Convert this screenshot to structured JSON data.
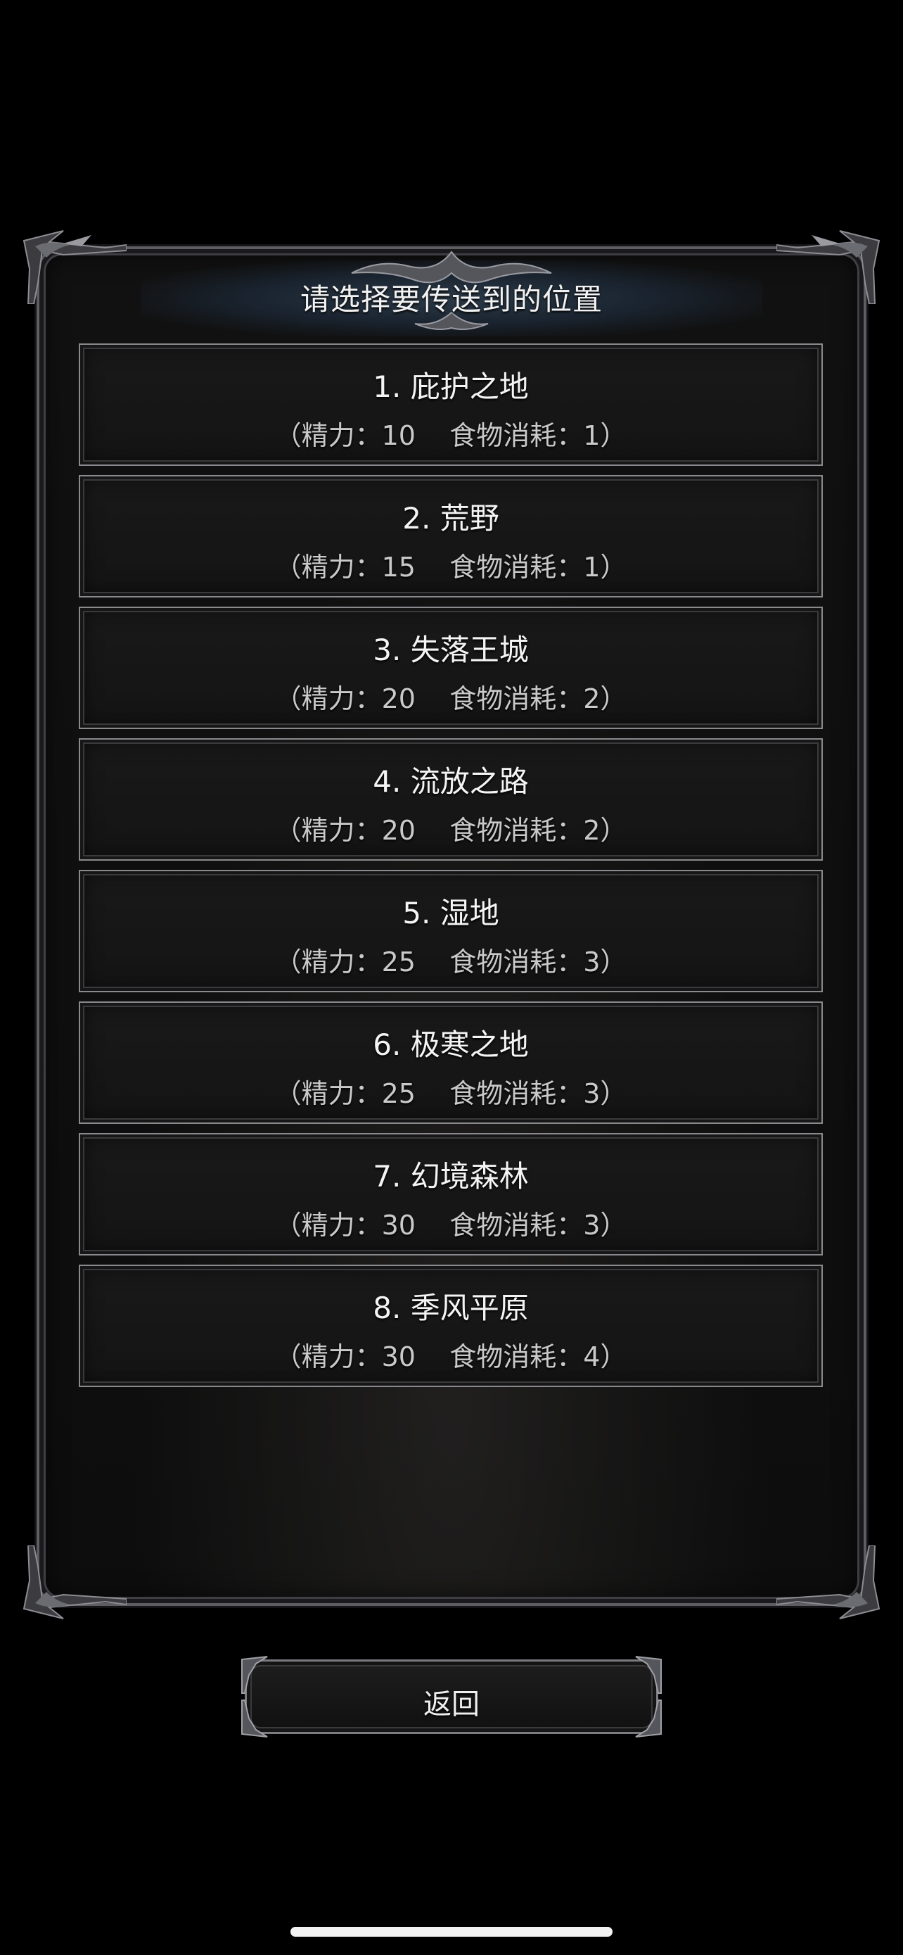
{
  "dialog": {
    "title": "请选择要传送到的位置"
  },
  "locations": [
    {
      "name": "1. 庇护之地",
      "cost": "（精力：10    食物消耗：1）"
    },
    {
      "name": "2. 荒野",
      "cost": "（精力：15    食物消耗：1）"
    },
    {
      "name": "3. 失落王城",
      "cost": "（精力：20    食物消耗：2）"
    },
    {
      "name": "4. 流放之路",
      "cost": "（精力：20    食物消耗：2）"
    },
    {
      "name": "5. 湿地",
      "cost": "（精力：25    食物消耗：3）"
    },
    {
      "name": "6. 极寒之地",
      "cost": "（精力：25    食物消耗：3）"
    },
    {
      "name": "7. 幻境森林",
      "cost": "（精力：30    食物消耗：3）"
    },
    {
      "name": "8. 季风平原",
      "cost": "（精力：30    食物消耗：4）"
    }
  ],
  "buttons": {
    "back_label": "返回"
  },
  "colors": {
    "background": "#000000",
    "panel": "#111111",
    "frame": "#5d5d62",
    "title_glow": "#2c3a48",
    "text": "#f4f4f4",
    "subtext": "#c9c9c9"
  }
}
